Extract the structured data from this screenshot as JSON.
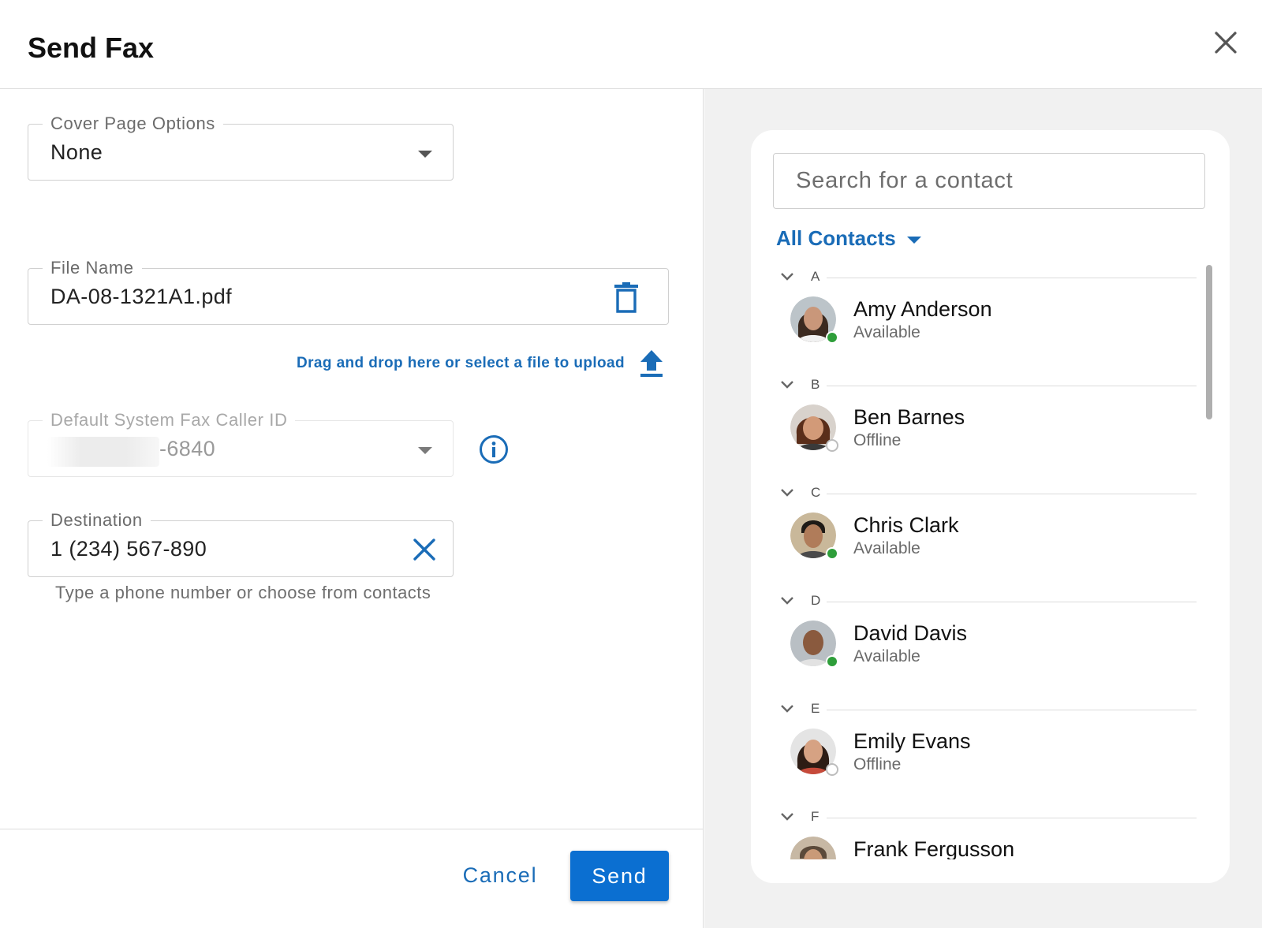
{
  "dialog": {
    "title": "Send Fax",
    "close_icon": "close-icon"
  },
  "form": {
    "cover_page": {
      "label": "Cover Page Options",
      "value": "None"
    },
    "file_name": {
      "label": "File Name",
      "value": "DA-08-1321A1.pdf",
      "delete_icon": "trash-icon"
    },
    "upload": {
      "text": "Drag and drop here or select a file to upload",
      "icon": "upload-icon"
    },
    "caller_id": {
      "label": "Default System Fax Caller ID",
      "value": "-6840",
      "info_icon": "info-icon"
    },
    "destination": {
      "label": "Destination",
      "value": "1 (234) 567-890",
      "clear_icon": "clear-icon",
      "helper": "Type a phone number or choose from contacts"
    }
  },
  "footer": {
    "cancel_label": "Cancel",
    "send_label": "Send"
  },
  "contacts": {
    "search_placeholder": "Search for a contact",
    "filter_label": "All Contacts",
    "groups": [
      {
        "letter": "A",
        "name": "Amy Anderson",
        "status": "Available"
      },
      {
        "letter": "B",
        "name": "Ben Barnes",
        "status": "Offline"
      },
      {
        "letter": "C",
        "name": "Chris Clark",
        "status": "Available"
      },
      {
        "letter": "D",
        "name": "David Davis",
        "status": "Available"
      },
      {
        "letter": "E",
        "name": "Emily Evans",
        "status": "Offline"
      },
      {
        "letter": "F",
        "name": "Frank Fergusson",
        "status": ""
      }
    ]
  },
  "colors": {
    "accent": "#1a6cb7",
    "primary_button": "#0b6fd1",
    "available": "#2e9e3a",
    "offline": "#ffffff"
  }
}
